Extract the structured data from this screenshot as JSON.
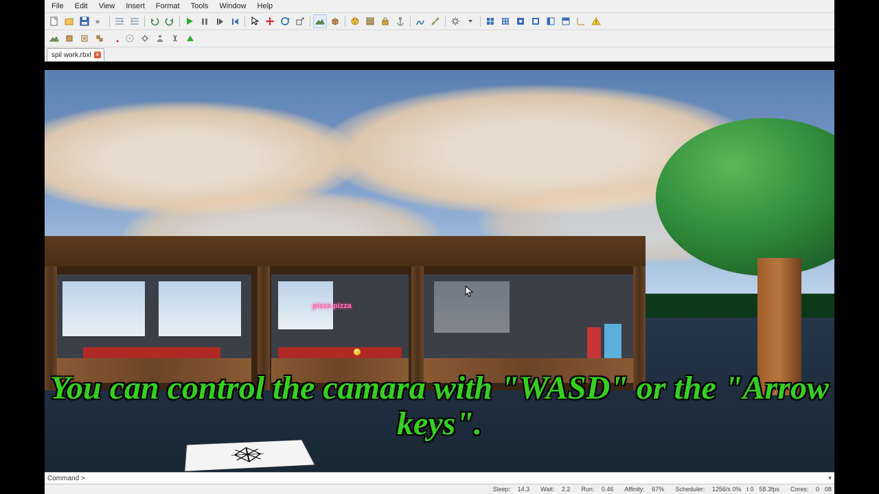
{
  "menu": {
    "file": "File",
    "edit": "Edit",
    "view": "View",
    "insert": "Insert",
    "format": "Format",
    "tools": "Tools",
    "window": "Window",
    "help": "Help"
  },
  "tab": {
    "name": "spil work.rbxl",
    "close": "×"
  },
  "caption": "You can control the camara with \"WASD\" or the \"Arrow keys\".",
  "scene": {
    "sign": "pizza pizza"
  },
  "cmd": {
    "label": "Command >"
  },
  "status": {
    "sleep_lbl": "Sleep:",
    "sleep": "14.3",
    "wait_lbl": "Wait:",
    "wait": "2.2",
    "run_lbl": "Run:",
    "run": "0.46",
    "aff_lbl": "Affinity:",
    "aff": "67%",
    "sched_lbl": "Scheduler:",
    "sched": "1256/s 0%",
    "t0": "t 0",
    "fps": "58.3fps",
    "cores_lbl": "Cores:",
    "cores": "0",
    "ob": "08"
  },
  "icons": {
    "new": "new",
    "open": "open",
    "save": "save",
    "chev": "»",
    "undo": "undo",
    "redo": "redo",
    "play": "play",
    "pause": "pause",
    "step": "step",
    "stop": "stop",
    "cursor": "cursor",
    "move": "move",
    "rotate": "rotate",
    "scale": "scale",
    "lock": "lock",
    "joint": "joint",
    "anchor": "anchor",
    "material": "material",
    "color": "color",
    "texture": "texture",
    "group": "group",
    "ungroup": "ungroup",
    "grid": "grid",
    "snap": "snap",
    "camera": "camera",
    "star": "star"
  }
}
